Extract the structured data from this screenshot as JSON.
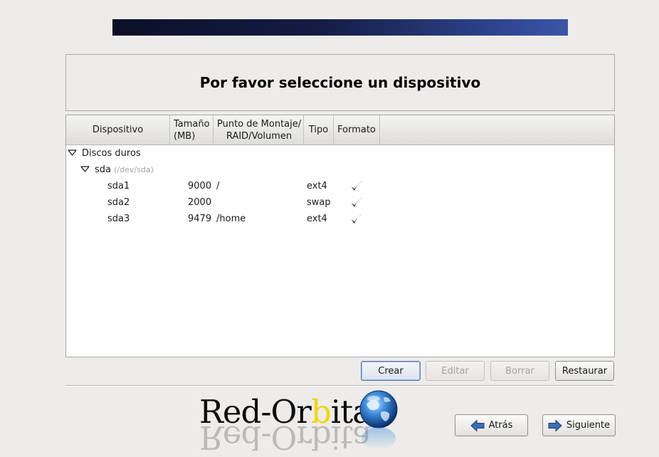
{
  "header": {
    "title": "Por favor seleccione un dispositivo"
  },
  "table": {
    "columns": {
      "device": "Dispositivo",
      "size_line1": "Tamaño",
      "size_line2": "(MB)",
      "mount_line1": "Punto de Montaje/",
      "mount_line2": "RAID/Volumen",
      "type": "Tipo",
      "format": "Formato"
    },
    "group": {
      "label": "Discos duros"
    },
    "disk": {
      "name": "sda",
      "path": "(/dev/sda)"
    },
    "partitions": [
      {
        "device": "sda1",
        "size": "9000",
        "mount": "/",
        "type": "ext4",
        "format": true
      },
      {
        "device": "sda2",
        "size": "2000",
        "mount": "",
        "type": "swap",
        "format": true
      },
      {
        "device": "sda3",
        "size": "9479",
        "mount": "/home",
        "type": "ext4",
        "format": true
      }
    ]
  },
  "actions": {
    "create": "Crear",
    "edit": "Editar",
    "delete": "Borrar",
    "reset": "Restaurar"
  },
  "nav": {
    "back": "Atrás",
    "next": "Siguiente"
  },
  "logo": {
    "text_part1": "Red-Or",
    "text_accent": "b",
    "text_part2": "ita"
  },
  "colors": {
    "banner_dark": "#0b0f26",
    "banner_light": "#3b56a8",
    "logo_accent": "#f0d600",
    "arrow_blue": "#3b6db5"
  }
}
